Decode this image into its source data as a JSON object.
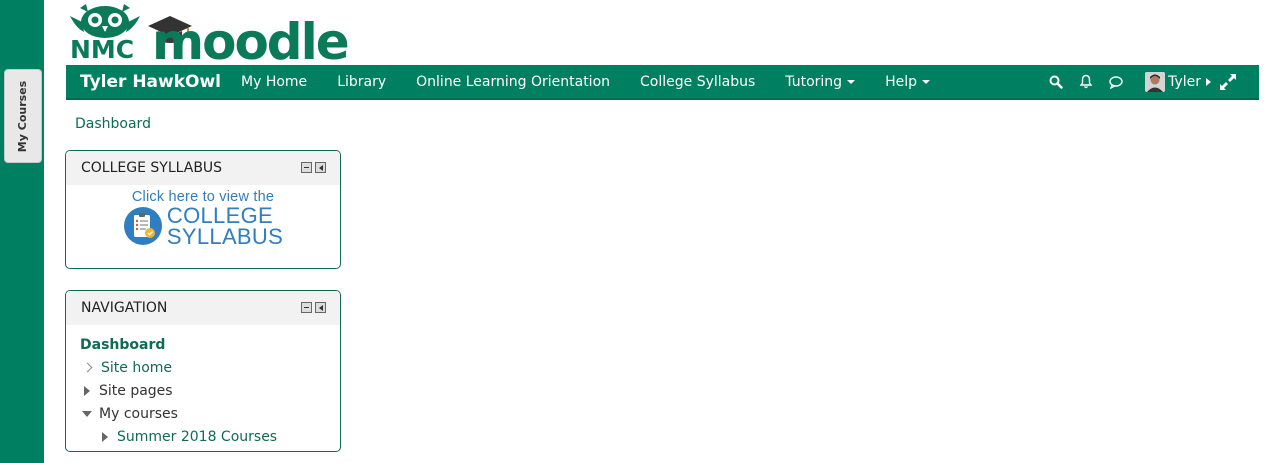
{
  "dock": {
    "tab_label": "My Courses"
  },
  "logo": {
    "nmc": "NMC",
    "word": "moodle"
  },
  "navbar": {
    "brand": "Tyler HawkOwl",
    "links": [
      {
        "label": "My Home",
        "dropdown": false
      },
      {
        "label": "Library",
        "dropdown": false
      },
      {
        "label": "Online Learning Orientation",
        "dropdown": false
      },
      {
        "label": "College Syllabus",
        "dropdown": false
      },
      {
        "label": "Tutoring",
        "dropdown": true
      },
      {
        "label": "Help",
        "dropdown": true
      }
    ],
    "icons": [
      "search-icon",
      "bell-icon",
      "message-icon"
    ],
    "user": "Tyler"
  },
  "breadcrumb": "Dashboard",
  "blocks": {
    "syllabus": {
      "title": "COLLEGE SYLLABUS",
      "line1": "Click here to view the",
      "line2": "COLLEGE",
      "line3": "SYLLABUS"
    },
    "navigation": {
      "title": "NAVIGATION",
      "items": [
        {
          "label": "Dashboard"
        },
        {
          "label": "Site home"
        },
        {
          "label": "Site pages"
        },
        {
          "label": "My courses"
        },
        {
          "label": "Summer 2018 Courses"
        }
      ]
    }
  },
  "colors": {
    "brand": "#008060",
    "link": "#0f6b54",
    "syllabus_blue": "#2f7ec1"
  }
}
